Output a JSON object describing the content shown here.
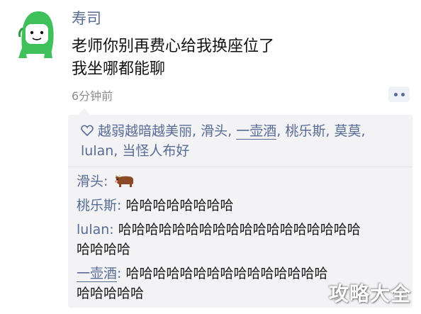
{
  "post": {
    "username": "寿司",
    "lines": [
      "老师你别再费心给我换座位了",
      "我坐哪都能聊"
    ],
    "timestamp": "6分钟前"
  },
  "likes": {
    "names": [
      "越弱越暗越美丽",
      "滑头",
      "一壶酒",
      "桃乐斯",
      "莫莫",
      "lulan",
      "当怪人布好"
    ],
    "separator": ", "
  },
  "comments": [
    {
      "name": "滑头",
      "colon": ": ",
      "text": "",
      "icon": "cow-emoji"
    },
    {
      "name": "桃乐斯",
      "colon": ": ",
      "text": "哈哈哈哈哈哈哈哈"
    },
    {
      "name": "lulan",
      "colon": ": ",
      "text": "哈哈哈哈哈哈哈哈哈哈哈哈哈哈哈哈哈哈",
      "text2": "哈哈哈哈"
    },
    {
      "name": "一壶酒",
      "colon": ": ",
      "text": "哈哈哈哈哈哈哈哈哈哈哈哈哈哈哈",
      "text2": "哈哈哈哈哈"
    }
  ],
  "watermark": "攻略大全",
  "colors": {
    "link": "#576b95",
    "bg_comment": "#f3f3f5",
    "avatar_green": "#3fc05a"
  }
}
